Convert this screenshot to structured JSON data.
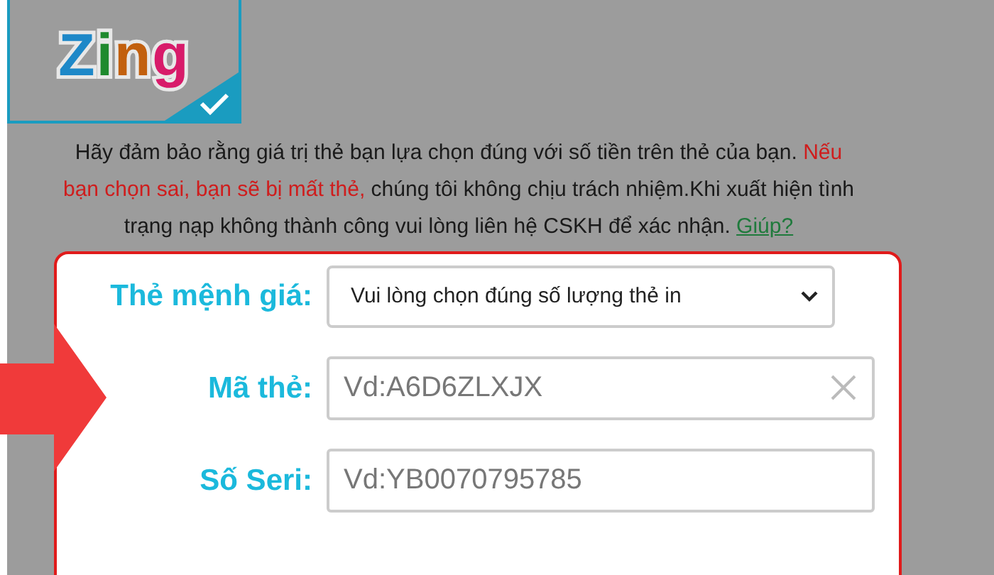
{
  "card_option": {
    "selected": true,
    "logo_letters": [
      {
        "text": "Z",
        "color": "#1e88c8"
      },
      {
        "text": "i",
        "color": "#1f8a2e"
      },
      {
        "text": "n",
        "color": "#c2600e"
      },
      {
        "text": "g",
        "color": "#d81b6a"
      }
    ]
  },
  "notice": {
    "segments": [
      {
        "kind": "normal",
        "text": "Hãy đảm bảo rằng giá trị thẻ bạn lựa chọn đúng với số tiền trên thẻ của bạn. "
      },
      {
        "kind": "warning",
        "text": "Nếu bạn chọn sai, bạn sẽ bị mất thẻ,"
      },
      {
        "kind": "normal",
        "text": " chúng tôi không chịu trách nhiệm.Khi xuất hiện tình trạng nạp không thành công vui lòng liên hệ CSKH để xác nhận. "
      },
      {
        "kind": "link",
        "text": "Giúp?"
      }
    ]
  },
  "form": {
    "fields": [
      {
        "kind": "select",
        "label": "Thẻ mệnh giá:",
        "value": "Vui lòng chọn đúng số lượng thẻ in"
      },
      {
        "kind": "input",
        "label": "Mã thẻ:",
        "placeholder": "Vd:A6D6ZLXJX",
        "clearable": true
      },
      {
        "kind": "input",
        "label": "Số Seri:",
        "placeholder": "Vd:YB0070795785",
        "clearable": false
      }
    ]
  }
}
